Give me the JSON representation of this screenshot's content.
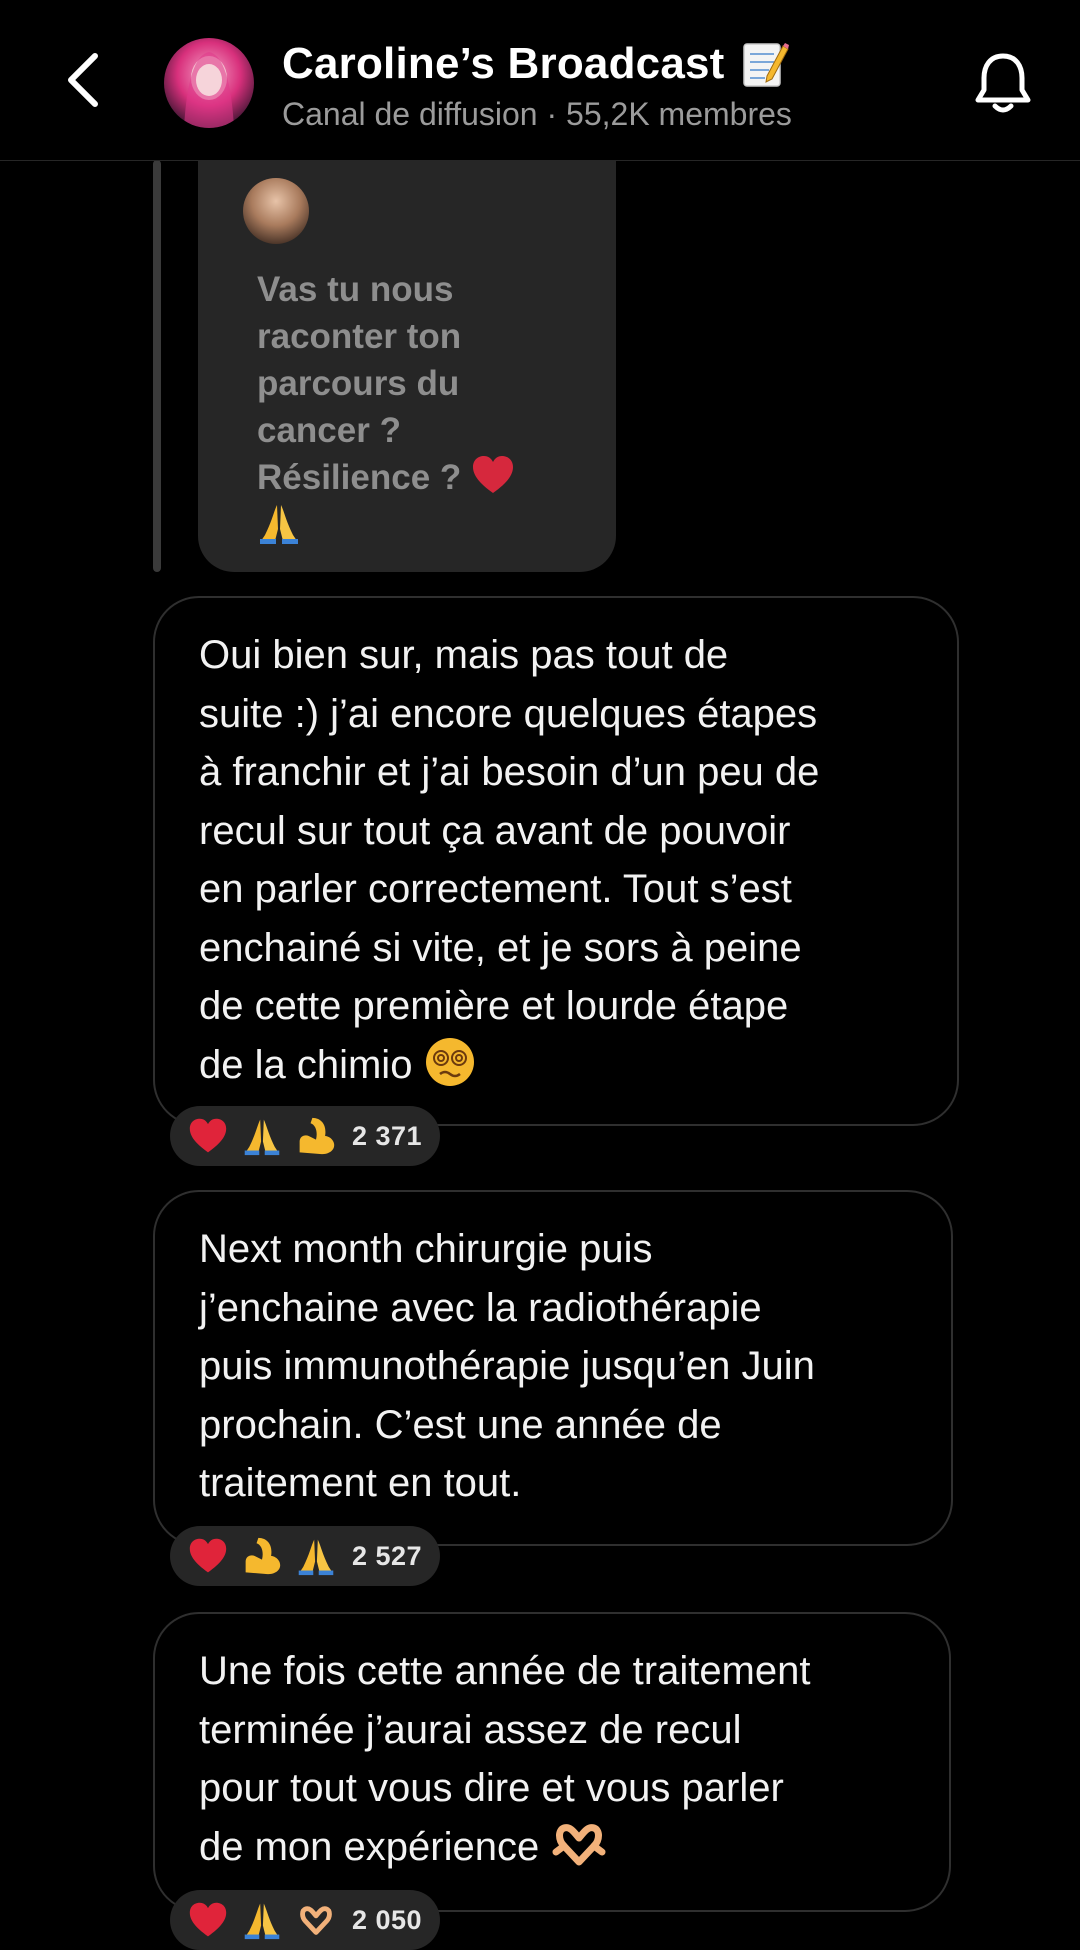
{
  "header": {
    "title": "Caroline’s Broadcast",
    "subtitle": "Canal de diffusion · 55,2K membres"
  },
  "quoted_story": {
    "text": "Vas tu nous\nraconter ton\nparcours du\ncancer ?\nRésilience ?"
  },
  "messages": [
    {
      "text": "Oui bien sur, mais pas tout de\nsuite :) j’ai encore quelques étapes\nà franchir et j’ai besoin d’un peu de\nrecul sur tout ça avant de pouvoir\nen parler correctement. Tout s’est\nenchainé si vite, et je sors à peine\nde cette première et lourde étape\nde la chimio",
      "reactions": [
        "heart",
        "praying-hands",
        "flexed-biceps"
      ],
      "reaction_count": "2 371"
    },
    {
      "text": "Next month chirurgie puis\nj’enchaine avec la radiothérapie\npuis immunothérapie jusqu’en Juin\nprochain. C’est une année de\ntraitement en tout.",
      "reactions": [
        "heart",
        "flexed-biceps",
        "praying-hands"
      ],
      "reaction_count": "2 527"
    },
    {
      "text": "Une fois cette année de traitement\nterminée j’aurai assez de recul\npour tout vous dire et vous parler\nde mon expérience",
      "reactions": [
        "heart",
        "praying-hands",
        "heart-hands"
      ],
      "reaction_count": "2 050"
    }
  ],
  "colors": {
    "background": "#000000",
    "bubble_border": "#2f2f2f",
    "quote_bubble": "#262626",
    "reaction_pill": "#262626",
    "heart": "#e0243a",
    "emoji_yellow": "#f5b82e"
  }
}
